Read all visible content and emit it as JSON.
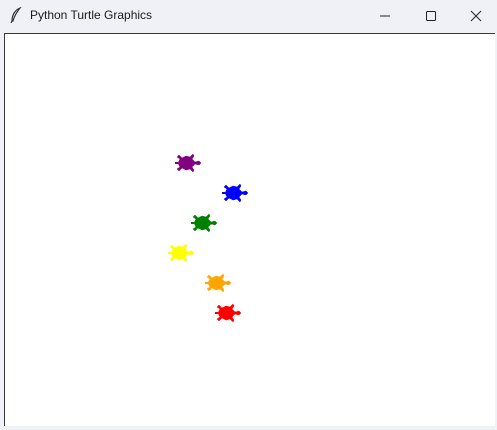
{
  "window": {
    "title": "Python Turtle Graphics",
    "controls": {
      "minimize": "minimize",
      "maximize": "maximize",
      "close": "close"
    }
  },
  "canvas": {
    "background": "#ffffff",
    "turtles": [
      {
        "color": "purple",
        "fill": "#800080",
        "heading": "east"
      },
      {
        "color": "blue",
        "fill": "#0000ff",
        "heading": "east"
      },
      {
        "color": "green",
        "fill": "#008000",
        "heading": "east"
      },
      {
        "color": "yellow",
        "fill": "#ffff00",
        "heading": "east"
      },
      {
        "color": "orange",
        "fill": "#ffa500",
        "heading": "east"
      },
      {
        "color": "red",
        "fill": "#ff0000",
        "heading": "east"
      }
    ]
  }
}
